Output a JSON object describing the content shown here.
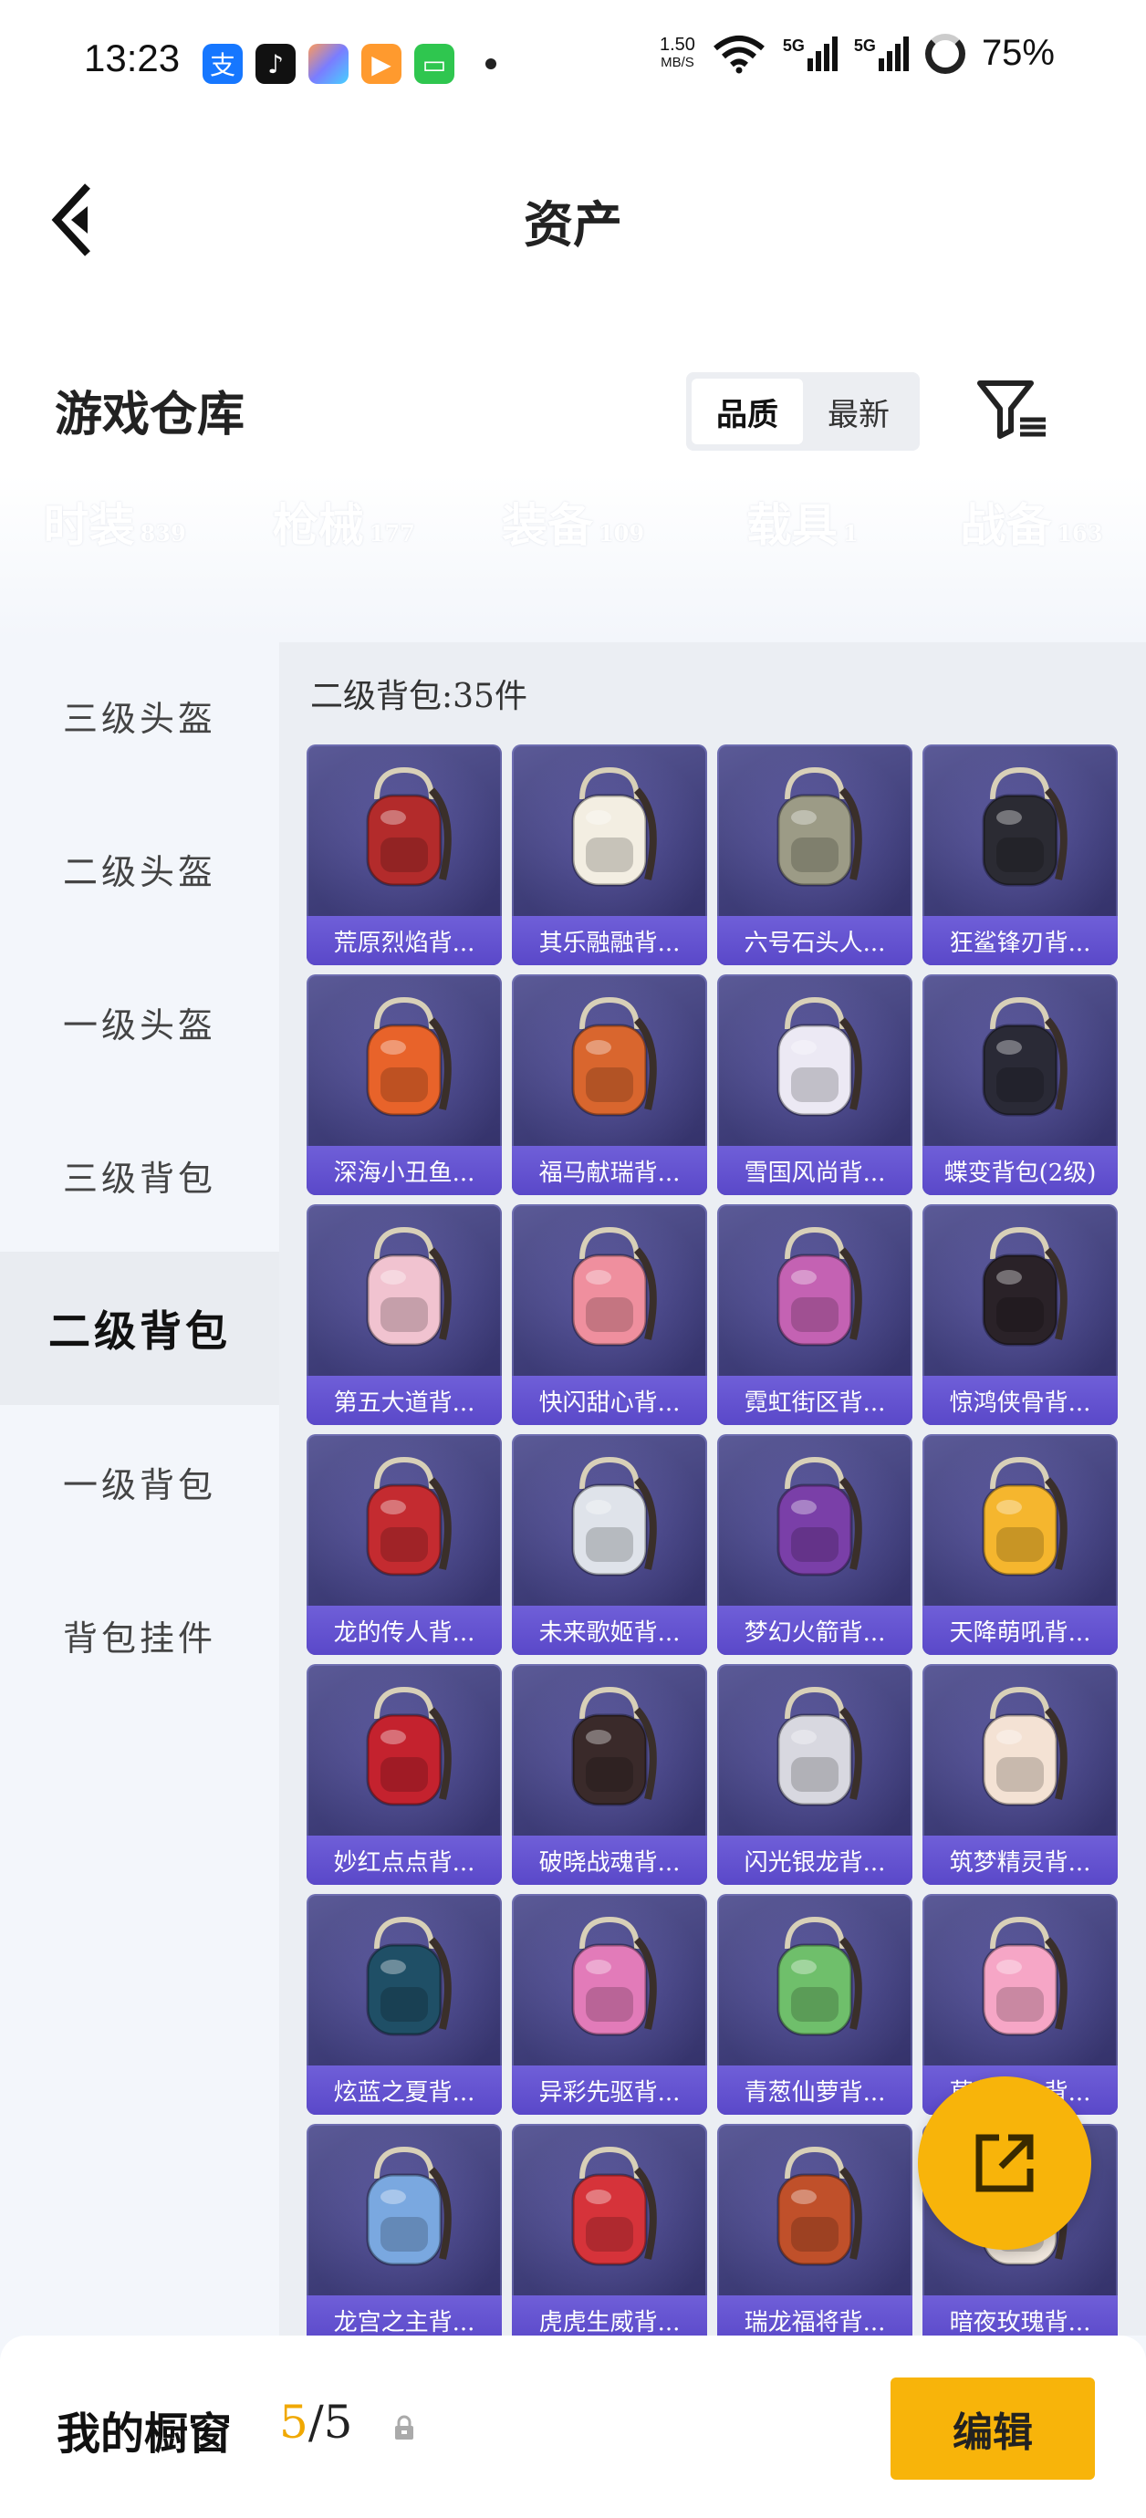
{
  "status_bar": {
    "time": "13:23",
    "speed_value": "1.50",
    "speed_unit": "MB/S",
    "net1": "5G",
    "net2": "5G",
    "battery": "75%"
  },
  "header": {
    "title": "资产"
  },
  "section": {
    "title": "游戏仓库",
    "sort_quality": "品质",
    "sort_latest": "最新"
  },
  "categories": [
    {
      "label": "时装",
      "count": "839"
    },
    {
      "label": "枪械",
      "count": "177"
    },
    {
      "label": "装备",
      "count": "109"
    },
    {
      "label": "载具",
      "count": "1"
    },
    {
      "label": "战备",
      "count": "163"
    }
  ],
  "sidebar": {
    "items": [
      {
        "label": "三级头盔"
      },
      {
        "label": "二级头盔"
      },
      {
        "label": "一级头盔"
      },
      {
        "label": "三级背包"
      },
      {
        "label": "二级背包"
      },
      {
        "label": "一级背包"
      },
      {
        "label": "背包挂件"
      }
    ]
  },
  "main": {
    "count_label": "二级背包:35件"
  },
  "items": [
    {
      "name": "荒原烈焰背...",
      "color": "#b32b2b"
    },
    {
      "name": "其乐融融背...",
      "color": "#f3eee2"
    },
    {
      "name": "六号石头人...",
      "color": "#9c9b86"
    },
    {
      "name": "狂鲨锋刃背...",
      "color": "#2b2b33"
    },
    {
      "name": "深海小丑鱼...",
      "color": "#e8632a"
    },
    {
      "name": "福马献瑞背...",
      "color": "#d9662e"
    },
    {
      "name": "雪国风尚背...",
      "color": "#ece9f4"
    },
    {
      "name": "蝶变背包(2级)",
      "color": "#2a2a36"
    },
    {
      "name": "第五大道背...",
      "color": "#f1c3d0"
    },
    {
      "name": "快闪甜心背...",
      "color": "#ef8f9e"
    },
    {
      "name": "霓虹街区背...",
      "color": "#c462b3"
    },
    {
      "name": "惊鸿侠骨背...",
      "color": "#2a2228"
    },
    {
      "name": "龙的传人背...",
      "color": "#c42b30"
    },
    {
      "name": "未来歌姬背...",
      "color": "#dfe3ea"
    },
    {
      "name": "梦幻火箭背...",
      "color": "#7a3fa8"
    },
    {
      "name": "天降萌吼背...",
      "color": "#f5b62e"
    },
    {
      "name": "妙红点点背...",
      "color": "#c4222e"
    },
    {
      "name": "破晓战魂背...",
      "color": "#3a2a2a"
    },
    {
      "name": "闪光银龙背...",
      "color": "#d8d8e0"
    },
    {
      "name": "筑梦精灵背...",
      "color": "#f4e2d4"
    },
    {
      "name": "炫蓝之夏背...",
      "color": "#1f4f66"
    },
    {
      "name": "异彩先驱背...",
      "color": "#e27bb9"
    },
    {
      "name": "青葱仙萝背...",
      "color": "#6fbf6b"
    },
    {
      "name": "草莓甜心背...",
      "color": "#f6a6c6"
    },
    {
      "name": "龙宫之主背...",
      "color": "#7aa8e0"
    },
    {
      "name": "虎虎生威背...",
      "color": "#d6333a"
    },
    {
      "name": "瑞龙福将背...",
      "color": "#c0502a"
    },
    {
      "name": "暗夜玫瑰背...",
      "color": "#efe6dc"
    }
  ],
  "bottom": {
    "showcase_label": "我的橱窗",
    "showcase_current": "5",
    "showcase_sep": "/",
    "showcase_total": "5",
    "edit_label": "编辑"
  }
}
